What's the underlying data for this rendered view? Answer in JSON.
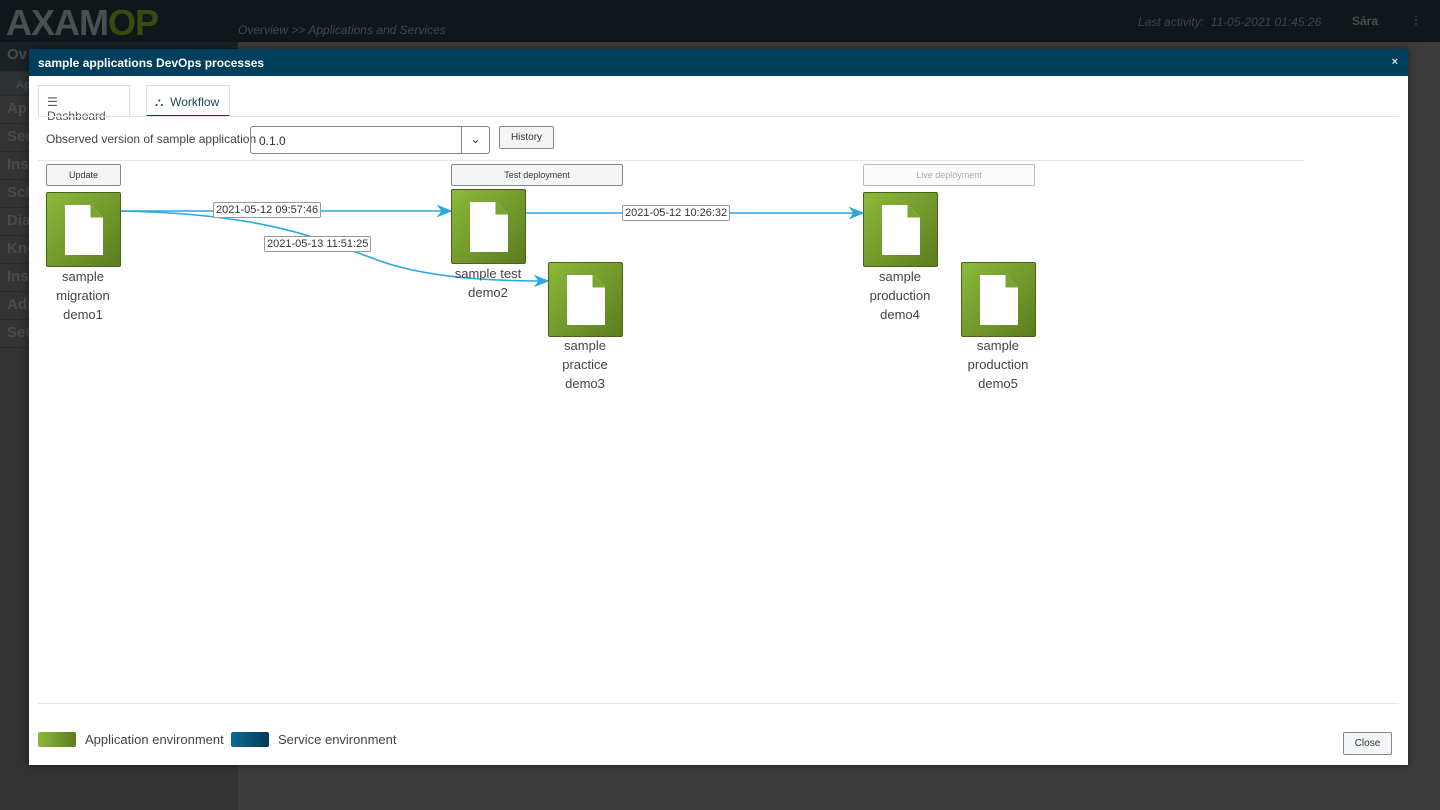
{
  "app": {
    "logo": "AXAMOP",
    "breadcrumb": "Overview >> Applications and Services",
    "last_activity_label": "Last activity:",
    "last_activity": "11-05-2021 01:45:26",
    "user": "Sára"
  },
  "sidebar": {
    "items": [
      "Ov",
      "Ap",
      "Ap",
      "Ser",
      "Ins",
      "Sch",
      "Dia",
      "Kno",
      "Ins",
      "Adr",
      "Set"
    ]
  },
  "modal": {
    "title": "sample applications DevOps processes",
    "close": "×",
    "tabs": [
      {
        "label": "Dashboard",
        "icon": "list-icon"
      },
      {
        "label": "Workflow",
        "icon": "sitemap-icon",
        "active": true
      }
    ],
    "version_label": "Observed version of sample application",
    "version_value": "0.1.0",
    "history_button": "History",
    "stages": [
      {
        "label": "Update",
        "enabled": true
      },
      {
        "label": "Test deployment",
        "enabled": true
      },
      {
        "label": "Live deployment",
        "enabled": false
      }
    ],
    "nodes": [
      {
        "label": [
          "sample",
          "migration",
          "demo1"
        ]
      },
      {
        "label": [
          "sample test",
          "demo2"
        ]
      },
      {
        "label": [
          "sample",
          "practice",
          "demo3"
        ]
      },
      {
        "label": [
          "sample",
          "production",
          "demo4"
        ]
      },
      {
        "label": [
          "sample",
          "production",
          "demo5"
        ]
      }
    ],
    "edges": [
      {
        "from": "demo1",
        "to": "demo2",
        "label": "2021-05-12 09:57:46"
      },
      {
        "from": "demo1",
        "to": "demo3",
        "label": "2021-05-13 11:51:25"
      },
      {
        "from": "demo2",
        "to": "demo4",
        "label": "2021-05-12 10:26:32"
      }
    ],
    "legend": [
      {
        "label": "Application environment",
        "color": "#7aa52e"
      },
      {
        "label": "Service environment",
        "color": "#0a5a80"
      }
    ],
    "close_button": "Close"
  },
  "colors": {
    "header": "#003f5c",
    "edge": "#29a8e0",
    "app_env": "#7aa52e",
    "service_env": "#0a5a80"
  }
}
